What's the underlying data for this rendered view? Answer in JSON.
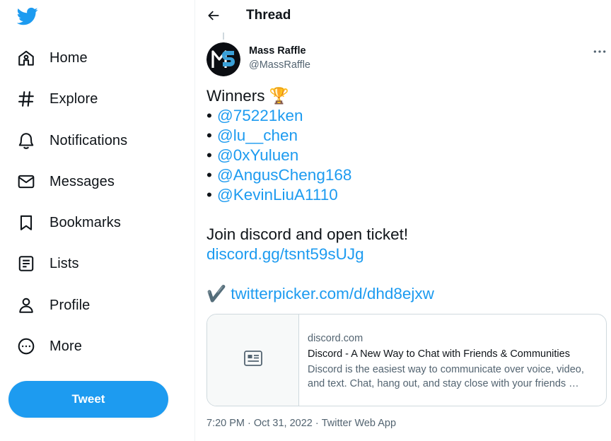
{
  "sidebar": {
    "items": [
      {
        "label": "Home",
        "icon": "home-icon"
      },
      {
        "label": "Explore",
        "icon": "hashtag-icon"
      },
      {
        "label": "Notifications",
        "icon": "bell-icon"
      },
      {
        "label": "Messages",
        "icon": "mail-icon"
      },
      {
        "label": "Bookmarks",
        "icon": "bookmark-icon"
      },
      {
        "label": "Lists",
        "icon": "list-icon"
      },
      {
        "label": "Profile",
        "icon": "person-icon"
      },
      {
        "label": "More",
        "icon": "more-circle-icon"
      }
    ],
    "tweet_button": "Tweet"
  },
  "header": {
    "title": "Thread"
  },
  "tweet": {
    "author_name": "Mass Raffle",
    "author_handle": "@MassRaffle",
    "heading": "Winners",
    "trophy": "🏆",
    "bullet": "•",
    "winners": [
      "@75221ken",
      "@lu__chen",
      "@0xYuluen",
      "@AngusCheng168",
      "@KevinLiuA1110"
    ],
    "join_text": "Join discord and open ticket!",
    "discord_link": "discord.gg/tsnt59sUJg",
    "check": "✔️",
    "picker_link": "twitterpicker.com/d/dhd8ejxw",
    "time": "7:20 PM",
    "date": "Oct 31, 2022",
    "source": "Twitter Web App",
    "separator": "·"
  },
  "card": {
    "domain": "discord.com",
    "title": "Discord - A New Way to Chat with Friends & Communities",
    "description": "Discord is the easiest way to communicate over voice, video, and text. Chat, hang out, and stay close with your friends …"
  },
  "colors": {
    "accent": "#1d9bf0",
    "text": "#0f1419",
    "secondary": "#536471",
    "border": "#cfd9de"
  }
}
